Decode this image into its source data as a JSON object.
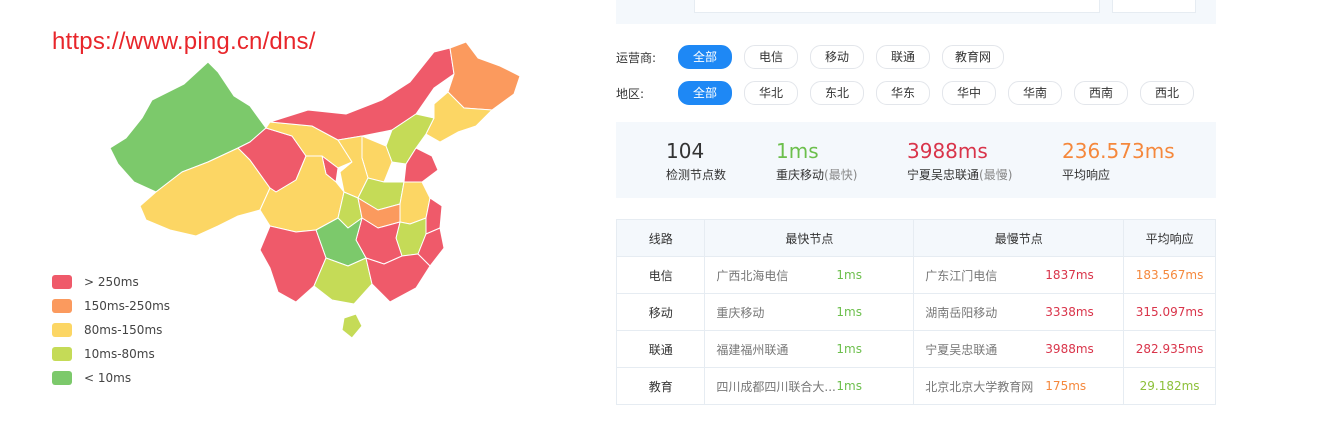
{
  "watermark": "https://www.ping.cn/dns/",
  "legend": [
    {
      "label": "> 250ms",
      "color": "#ef5a6a"
    },
    {
      "label": "150ms-250ms",
      "color": "#fb9a5e"
    },
    {
      "label": "80ms-150ms",
      "color": "#fcd664"
    },
    {
      "label": "10ms-80ms",
      "color": "#c5db57"
    },
    {
      "label": "< 10ms",
      "color": "#7cc96b"
    }
  ],
  "filters": {
    "isp": {
      "label": "运营商:",
      "options": [
        "全部",
        "电信",
        "移动",
        "联通",
        "教育网"
      ],
      "active": "全部"
    },
    "region": {
      "label": "地区:",
      "options": [
        "全部",
        "华北",
        "东北",
        "华东",
        "华中",
        "华南",
        "西南",
        "西北"
      ],
      "active": "全部"
    }
  },
  "summary": {
    "count": {
      "value": "104",
      "label": "检测节点数"
    },
    "fastest": {
      "value": "1ms",
      "label": "重庆移动",
      "note": "(最快)"
    },
    "slowest": {
      "value": "3988ms",
      "label": "宁夏吴忠联通",
      "note": "(最慢)"
    },
    "average": {
      "value": "236.573ms",
      "label": "平均响应"
    }
  },
  "colors": {
    "fast": "#6cbf4c",
    "slow": "#d9344a",
    "orange": "#f5883c",
    "lightgreen": "#8dc03a",
    "accent": "#1e88f5"
  },
  "table": {
    "headers": [
      "线路",
      "最快节点",
      "最慢节点",
      "平均响应"
    ],
    "rows": [
      {
        "line": "电信",
        "fast_node": "广西北海电信",
        "fast_ms": "1ms",
        "slow_node": "广东江门电信",
        "slow_ms": "1837ms",
        "avg": "183.567ms",
        "slow_color": "#d9344a",
        "avg_color": "#f5883c"
      },
      {
        "line": "移动",
        "fast_node": "重庆移动",
        "fast_ms": "1ms",
        "slow_node": "湖南岳阳移动",
        "slow_ms": "3338ms",
        "avg": "315.097ms",
        "slow_color": "#d9344a",
        "avg_color": "#d9344a"
      },
      {
        "line": "联通",
        "fast_node": "福建福州联通",
        "fast_ms": "1ms",
        "slow_node": "宁夏吴忠联通",
        "slow_ms": "3988ms",
        "avg": "282.935ms",
        "slow_color": "#d9344a",
        "avg_color": "#d9344a"
      },
      {
        "line": "教育",
        "fast_node": "四川成都四川联合大...",
        "fast_ms": "1ms",
        "slow_node": "北京北京大学教育网",
        "slow_ms": "175ms",
        "avg": "29.182ms",
        "slow_color": "#f5883c",
        "avg_color": "#8dc03a"
      }
    ]
  }
}
